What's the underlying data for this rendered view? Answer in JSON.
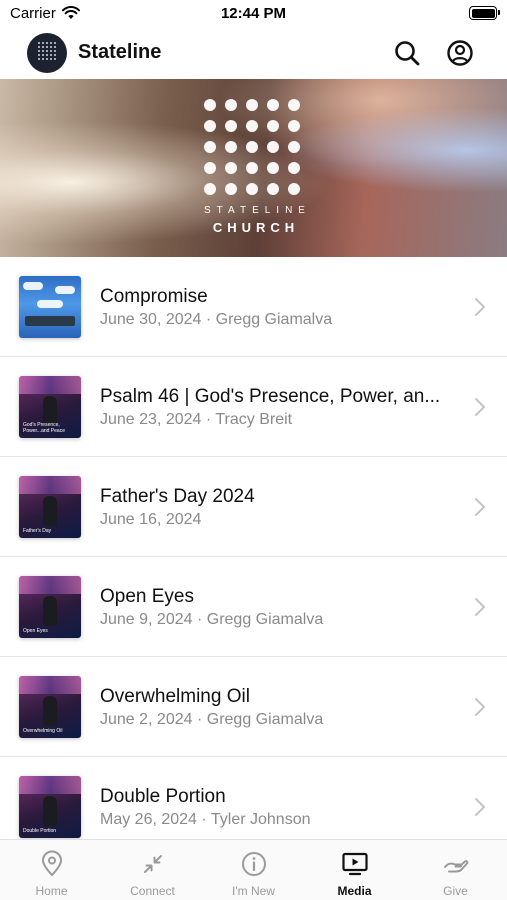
{
  "status_bar": {
    "carrier": "Carrier",
    "time": "12:44 PM"
  },
  "header": {
    "title": "Stateline",
    "search_icon": "search-icon",
    "account_icon": "account-icon"
  },
  "hero": {
    "line1": "STATELINE",
    "line2": "CHURCH"
  },
  "media_items": [
    {
      "title": "Compromise",
      "subtitle": "June 30, 2024 · Gregg Giamalva",
      "thumb_caption": ""
    },
    {
      "title": "Psalm 46 | God's Presence, Power, an...",
      "subtitle": "June 23, 2024 · Tracy Breit",
      "thumb_caption": "God's Presence, Power...and Peace"
    },
    {
      "title": "Father's Day 2024",
      "subtitle": "June 16, 2024",
      "thumb_caption": "Father's Day"
    },
    {
      "title": "Open Eyes",
      "subtitle": "June 9, 2024 · Gregg Giamalva",
      "thumb_caption": "Open Eyes"
    },
    {
      "title": "Overwhelming Oil",
      "subtitle": "June 2, 2024 · Gregg Giamalva",
      "thumb_caption": "Overwhelming Oil"
    },
    {
      "title": "Double Portion",
      "subtitle": "May 26, 2024 · Tyler Johnson",
      "thumb_caption": "Double Portion"
    }
  ],
  "tabs": [
    {
      "label": "Home",
      "icon": "location-pin-icon"
    },
    {
      "label": "Connect",
      "icon": "connect-arrows-icon"
    },
    {
      "label": "I'm New",
      "icon": "info-icon"
    },
    {
      "label": "Media",
      "icon": "media-play-icon"
    },
    {
      "label": "Give",
      "icon": "give-hand-icon"
    }
  ],
  "colors": {
    "active_tab": "#111111",
    "inactive_tab": "#9a9a9a",
    "subtitle": "#8a8a8a",
    "logo_bg": "#1c2230"
  }
}
